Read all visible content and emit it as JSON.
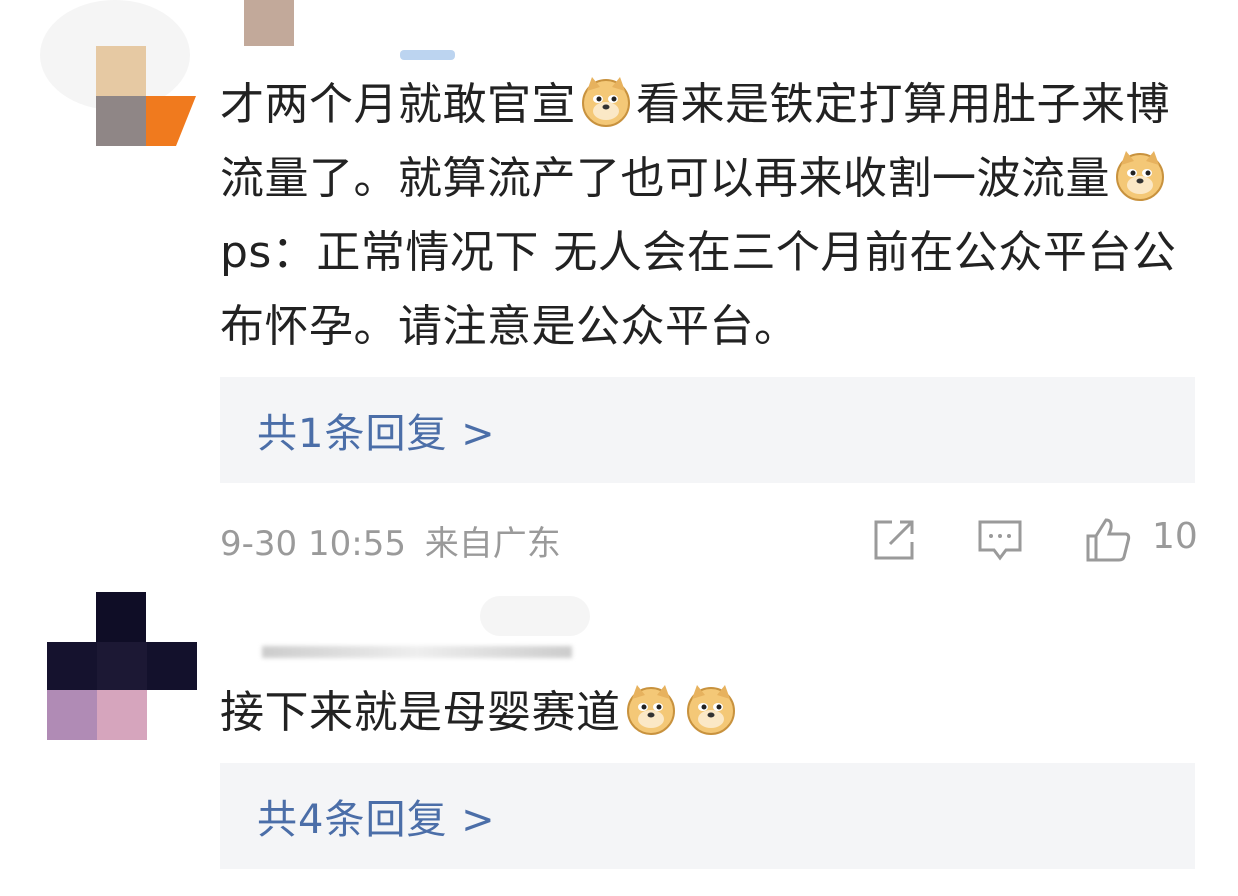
{
  "comments": [
    {
      "text_segments": [
        {
          "type": "text",
          "value": "才两个月就敢官宣"
        },
        {
          "type": "emoji",
          "name": "doge-emoji"
        },
        {
          "type": "text",
          "value": "看来是铁定打算用肚子来博流量了。就算流产了也可以再来收割一波流量"
        },
        {
          "type": "emoji",
          "name": "doge-emoji"
        },
        {
          "type": "text",
          "value": "ps：正常情况下  无人会在三个月前在公众平台公布怀孕。请注意是公众平台。"
        }
      ],
      "reply_label": "共1条回复 >",
      "meta": {
        "date": "9-30 10:55",
        "location": "来自广东"
      },
      "like_count": "10"
    },
    {
      "text_segments": [
        {
          "type": "text",
          "value": "接下来就是母婴赛道"
        },
        {
          "type": "emoji",
          "name": "doge-emoji"
        },
        {
          "type": "emoji",
          "name": "doge-emoji"
        }
      ],
      "reply_label": "共4条回复 >"
    }
  ],
  "icons": [
    "share-icon",
    "comment-icon",
    "like-icon",
    "doge-emoji"
  ],
  "colors": {
    "reply_link": "#4b6ea8",
    "reply_bg": "#f4f5f7",
    "meta": "#9a9a9a",
    "text": "#222222"
  }
}
